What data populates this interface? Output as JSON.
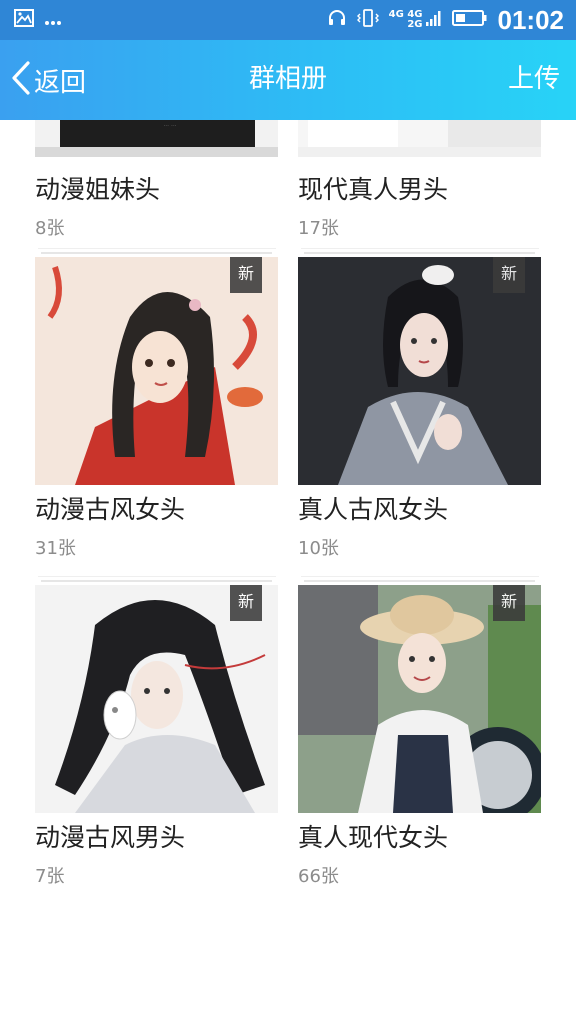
{
  "status_bar": {
    "time": "01:02",
    "network_top": "4G 4G",
    "network_bottom": "2G",
    "icons": [
      "image-icon",
      "more-icon",
      "headset-icon",
      "vibrate-icon",
      "signal-icon",
      "battery-icon"
    ]
  },
  "nav": {
    "back_label": "返回",
    "title": "群相册",
    "upload_label": "上传"
  },
  "albums": [
    {
      "title": "动漫姐妹头",
      "count": "8张",
      "new": false
    },
    {
      "title": "现代真人男头",
      "count": "17张",
      "new": false
    },
    {
      "title": "动漫古风女头",
      "count": "31张",
      "new": true,
      "badge": "新"
    },
    {
      "title": "真人古风女头",
      "count": "10张",
      "new": true,
      "badge": "新"
    },
    {
      "title": "动漫古风男头",
      "count": "7张",
      "new": true,
      "badge": "新"
    },
    {
      "title": "真人现代女头",
      "count": "66张",
      "new": true,
      "badge": "新"
    }
  ],
  "colors": {
    "nav_start": "#3aa0f0",
    "nav_end": "#28d3f7",
    "status_bar": "#2f86d6"
  }
}
